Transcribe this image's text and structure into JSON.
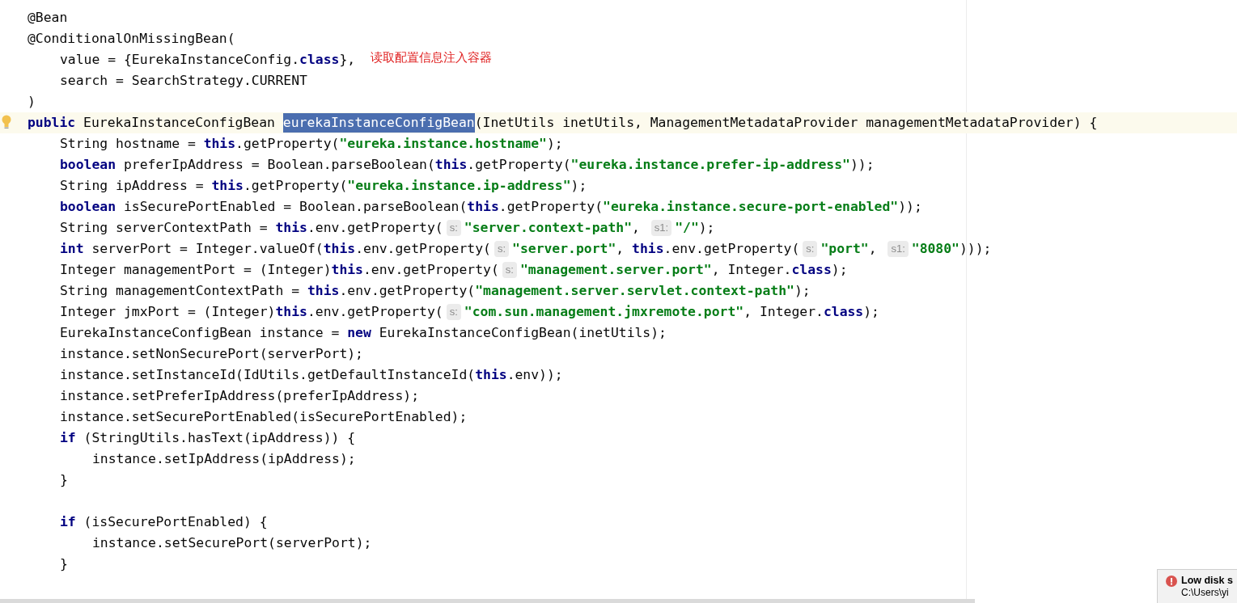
{
  "annotation": {
    "text": "读取配置信息注入容器"
  },
  "lines": [
    {
      "kind": "code",
      "current": false,
      "tokens": [
        {
          "kind": "t",
          "text": "@Bean"
        }
      ]
    },
    {
      "kind": "code",
      "current": false,
      "tokens": [
        {
          "kind": "t",
          "text": "@ConditionalOnMissingBean("
        }
      ],
      "children": [
        {
          "kind": "code",
          "current": false,
          "tokens": [
            {
              "kind": "t",
              "text": "value = {EurekaInstanceConfig."
            },
            {
              "kind": "k",
              "text": "class"
            },
            {
              "kind": "t",
              "text": "},"
            }
          ]
        },
        {
          "kind": "code",
          "current": false,
          "tokens": [
            {
              "kind": "t",
              "text": "search = SearchStrategy.CURRENT"
            }
          ]
        }
      ]
    },
    {
      "kind": "code",
      "current": false,
      "tokens": [
        {
          "kind": "t",
          "text": ")"
        }
      ]
    },
    {
      "kind": "code",
      "current": true,
      "tokens": [
        {
          "kind": "k",
          "text": "public"
        },
        {
          "kind": "t",
          "text": " EurekaInstanceConfigBean "
        },
        {
          "kind": "sel",
          "text": "eurekaInstanceConfigBean"
        },
        {
          "kind": "t",
          "text": "(InetUtils inetUtils, ManagementMetadataProvider managementMetadataProvider) {"
        }
      ],
      "children": [
        {
          "kind": "code",
          "current": false,
          "tokens": [
            {
              "kind": "t",
              "text": "String hostname = "
            },
            {
              "kind": "k",
              "text": "this"
            },
            {
              "kind": "t",
              "text": ".getProperty("
            },
            {
              "kind": "s",
              "text": "\"eureka.instance.hostname\""
            },
            {
              "kind": "t",
              "text": ");"
            }
          ]
        },
        {
          "kind": "code",
          "current": false,
          "tokens": [
            {
              "kind": "k",
              "text": "boolean"
            },
            {
              "kind": "t",
              "text": " preferIpAddress = Boolean.parseBoolean("
            },
            {
              "kind": "k",
              "text": "this"
            },
            {
              "kind": "t",
              "text": ".getProperty("
            },
            {
              "kind": "s",
              "text": "\"eureka.instance.prefer-ip-address\""
            },
            {
              "kind": "t",
              "text": "));"
            }
          ]
        },
        {
          "kind": "code",
          "current": false,
          "tokens": [
            {
              "kind": "t",
              "text": "String ipAddress = "
            },
            {
              "kind": "k",
              "text": "this"
            },
            {
              "kind": "t",
              "text": ".getProperty("
            },
            {
              "kind": "s",
              "text": "\"eureka.instance.ip-address\""
            },
            {
              "kind": "t",
              "text": ");"
            }
          ]
        },
        {
          "kind": "code",
          "current": false,
          "tokens": [
            {
              "kind": "k",
              "text": "boolean"
            },
            {
              "kind": "t",
              "text": " isSecurePortEnabled = Boolean.parseBoolean("
            },
            {
              "kind": "k",
              "text": "this"
            },
            {
              "kind": "t",
              "text": ".getProperty("
            },
            {
              "kind": "s",
              "text": "\"eureka.instance.secure-port-enabled\""
            },
            {
              "kind": "t",
              "text": "));"
            }
          ]
        },
        {
          "kind": "code",
          "current": false,
          "tokens": [
            {
              "kind": "t",
              "text": "String serverContextPath = "
            },
            {
              "kind": "k",
              "text": "this"
            },
            {
              "kind": "t",
              "text": ".env.getProperty("
            },
            {
              "kind": "h",
              "text": "s:"
            },
            {
              "kind": "s",
              "text": "\"server.context-path\""
            },
            {
              "kind": "t",
              "text": ", "
            },
            {
              "kind": "h",
              "text": "s1:"
            },
            {
              "kind": "s",
              "text": "\"/\""
            },
            {
              "kind": "t",
              "text": ");"
            }
          ]
        },
        {
          "kind": "code",
          "current": false,
          "tokens": [
            {
              "kind": "k",
              "text": "int"
            },
            {
              "kind": "t",
              "text": " serverPort = Integer.valueOf("
            },
            {
              "kind": "k",
              "text": "this"
            },
            {
              "kind": "t",
              "text": ".env.getProperty("
            },
            {
              "kind": "h",
              "text": "s:"
            },
            {
              "kind": "s",
              "text": "\"server.port\""
            },
            {
              "kind": "t",
              "text": ", "
            },
            {
              "kind": "k",
              "text": "this"
            },
            {
              "kind": "t",
              "text": ".env.getProperty("
            },
            {
              "kind": "h",
              "text": "s:"
            },
            {
              "kind": "s",
              "text": "\"port\""
            },
            {
              "kind": "t",
              "text": ", "
            },
            {
              "kind": "h",
              "text": "s1:"
            },
            {
              "kind": "s",
              "text": "\"8080\""
            },
            {
              "kind": "t",
              "text": ")));"
            }
          ]
        },
        {
          "kind": "code",
          "current": false,
          "tokens": [
            {
              "kind": "t",
              "text": "Integer managementPort = (Integer)"
            },
            {
              "kind": "k",
              "text": "this"
            },
            {
              "kind": "t",
              "text": ".env.getProperty("
            },
            {
              "kind": "h",
              "text": "s:"
            },
            {
              "kind": "s",
              "text": "\"management.server.port\""
            },
            {
              "kind": "t",
              "text": ", Integer."
            },
            {
              "kind": "k",
              "text": "class"
            },
            {
              "kind": "t",
              "text": ");"
            }
          ]
        },
        {
          "kind": "code",
          "current": false,
          "tokens": [
            {
              "kind": "t",
              "text": "String managementContextPath = "
            },
            {
              "kind": "k",
              "text": "this"
            },
            {
              "kind": "t",
              "text": ".env.getProperty("
            },
            {
              "kind": "s",
              "text": "\"management.server.servlet.context-path\""
            },
            {
              "kind": "t",
              "text": ");"
            }
          ]
        },
        {
          "kind": "code",
          "current": false,
          "tokens": [
            {
              "kind": "t",
              "text": "Integer jmxPort = (Integer)"
            },
            {
              "kind": "k",
              "text": "this"
            },
            {
              "kind": "t",
              "text": ".env.getProperty("
            },
            {
              "kind": "h",
              "text": "s:"
            },
            {
              "kind": "s",
              "text": "\"com.sun.management.jmxremote.port\""
            },
            {
              "kind": "t",
              "text": ", Integer."
            },
            {
              "kind": "k",
              "text": "class"
            },
            {
              "kind": "t",
              "text": ");"
            }
          ]
        },
        {
          "kind": "code",
          "current": false,
          "tokens": [
            {
              "kind": "t",
              "text": "EurekaInstanceConfigBean instance = "
            },
            {
              "kind": "k",
              "text": "new"
            },
            {
              "kind": "t",
              "text": " EurekaInstanceConfigBean(inetUtils);"
            }
          ]
        },
        {
          "kind": "code",
          "current": false,
          "tokens": [
            {
              "kind": "t",
              "text": "instance.setNonSecurePort(serverPort);"
            }
          ]
        },
        {
          "kind": "code",
          "current": false,
          "tokens": [
            {
              "kind": "t",
              "text": "instance.setInstanceId(IdUtils.getDefaultInstanceId("
            },
            {
              "kind": "k",
              "text": "this"
            },
            {
              "kind": "t",
              "text": ".env));"
            }
          ]
        },
        {
          "kind": "code",
          "current": false,
          "tokens": [
            {
              "kind": "t",
              "text": "instance.setPreferIpAddress(preferIpAddress);"
            }
          ]
        },
        {
          "kind": "code",
          "current": false,
          "tokens": [
            {
              "kind": "t",
              "text": "instance.setSecurePortEnabled(isSecurePortEnabled);"
            }
          ]
        },
        {
          "kind": "code",
          "current": false,
          "tokens": [
            {
              "kind": "k",
              "text": "if"
            },
            {
              "kind": "t",
              "text": " (StringUtils.hasText(ipAddress)) {"
            }
          ],
          "children": [
            {
              "kind": "code",
              "current": false,
              "tokens": [
                {
                  "kind": "t",
                  "text": "instance.setIpAddress(ipAddress);"
                }
              ]
            }
          ]
        },
        {
          "kind": "code",
          "current": false,
          "tokens": [
            {
              "kind": "t",
              "text": "}"
            }
          ]
        },
        {
          "kind": "blank"
        },
        {
          "kind": "code",
          "current": false,
          "tokens": [
            {
              "kind": "k",
              "text": "if"
            },
            {
              "kind": "t",
              "text": " (isSecurePortEnabled) {"
            }
          ],
          "children": [
            {
              "kind": "code",
              "current": false,
              "tokens": [
                {
                  "kind": "t",
                  "text": "instance.setSecurePort(serverPort);"
                }
              ]
            }
          ]
        },
        {
          "kind": "code",
          "current": false,
          "tokens": [
            {
              "kind": "t",
              "text": "}"
            }
          ]
        },
        {
          "kind": "blank"
        }
      ]
    }
  ],
  "notification": {
    "title": "Low disk s",
    "body": "C:\\Users\\yi"
  }
}
